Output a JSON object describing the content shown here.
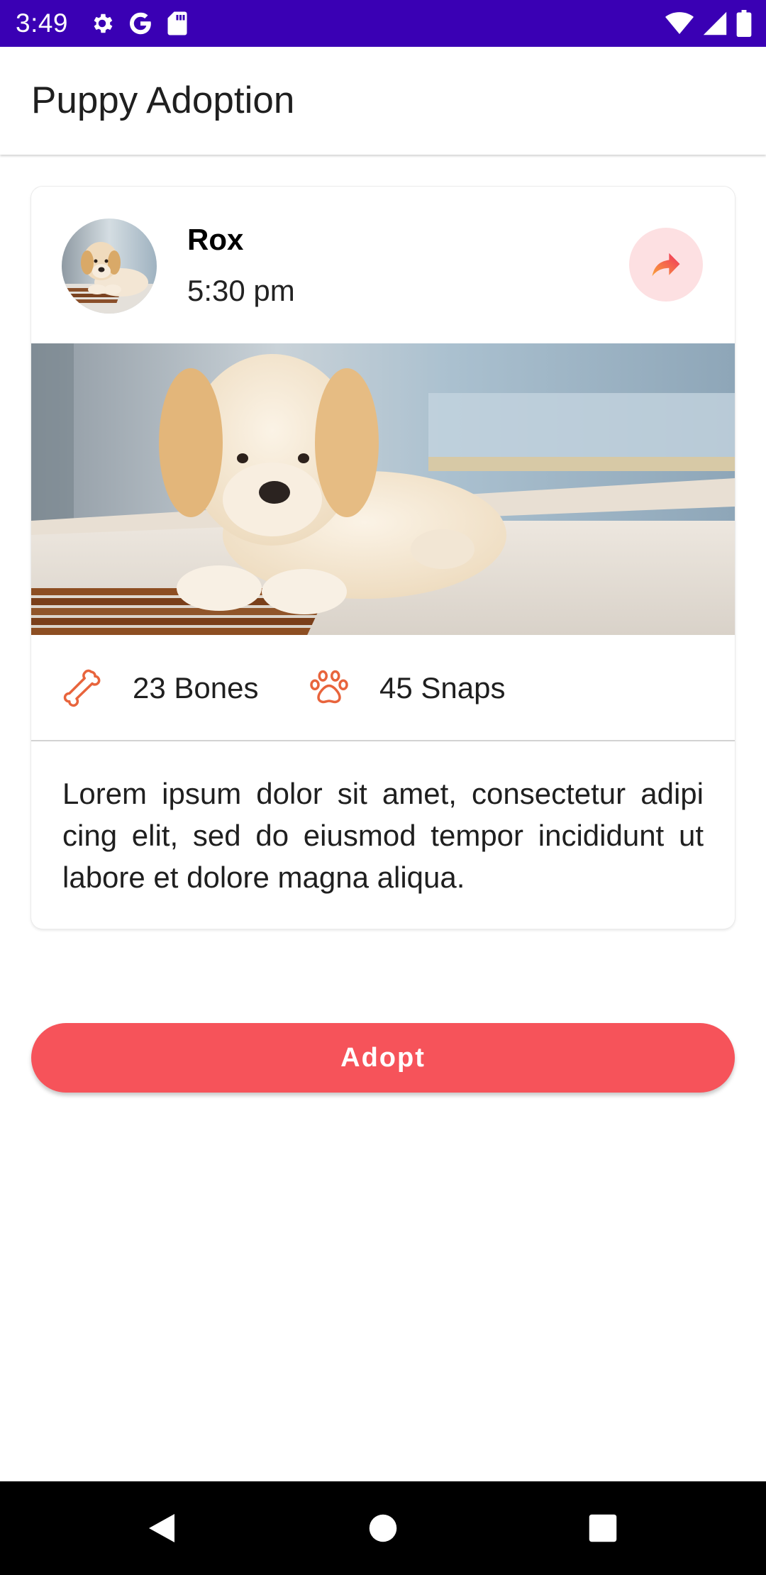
{
  "status_bar": {
    "time": "3:49",
    "background": "#3a00b4",
    "left_icons": [
      "settings-icon",
      "google-icon",
      "sd-card-icon"
    ],
    "right_icons": [
      "wifi-icon",
      "signal-icon",
      "battery-icon"
    ]
  },
  "app_bar": {
    "title": "Puppy Adoption"
  },
  "card": {
    "pet_name": "Rox",
    "time": "5:30 pm",
    "share_icon": "share-icon",
    "stats": {
      "bones": {
        "icon": "bone-icon",
        "label": "23 Bones"
      },
      "snaps": {
        "icon": "paw-icon",
        "label": "45 Snaps"
      }
    },
    "description": "Lorem ipsum dolor sit amet, consectetur adipi cing elit, sed do eiusmod tempor incididunt ut labore et dolore magna aliqua."
  },
  "adopt_button": {
    "label": "Adopt"
  },
  "nav_bar": {
    "buttons": [
      "back-icon",
      "home-icon",
      "recents-icon"
    ]
  },
  "colors": {
    "accent": "#f6535a",
    "icon_orange": "#e8643c",
    "share_bg": "#fde0e2",
    "status_bar": "#3a00b4"
  }
}
